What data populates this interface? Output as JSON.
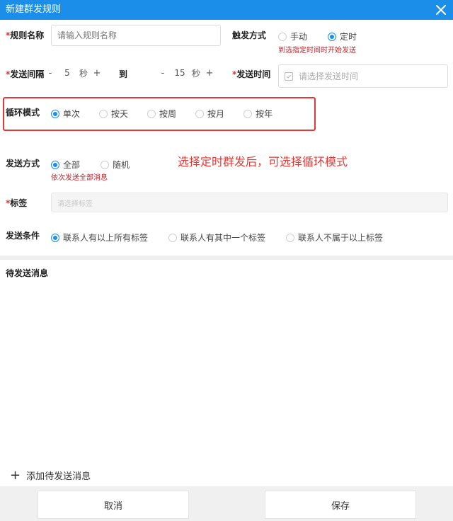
{
  "dialog": {
    "title": "新建群发规则"
  },
  "form": {
    "rule_name": {
      "required_mark": "*",
      "label": "规则名称",
      "placeholder": "请输入规则名称"
    },
    "trigger": {
      "label": "触发方式",
      "options": [
        "手动",
        "定时"
      ],
      "selected": "定时",
      "hint": "到选指定时间时开始发送"
    },
    "interval": {
      "required_mark": "*",
      "label": "发送间隔",
      "from": {
        "minus": "-",
        "value": "5",
        "unit": "秒",
        "plus": "+"
      },
      "to_label": "到",
      "to": {
        "minus": "-",
        "value": "15",
        "unit": "秒",
        "plus": "+"
      }
    },
    "send_time": {
      "required_mark": "*",
      "label": "发送时间",
      "placeholder": "请选择发送时间"
    },
    "loop_mode": {
      "label": "循环模式",
      "options": [
        "单次",
        "按天",
        "按周",
        "按月",
        "按年"
      ],
      "selected": "单次"
    },
    "send_method": {
      "label": "发送方式",
      "options": [
        "全部",
        "随机"
      ],
      "selected": "全部",
      "hint": "依次发送全部消息"
    },
    "tags": {
      "required_mark": "*",
      "label": "标签",
      "placeholder": "请选择标签"
    },
    "send_condition": {
      "label": "发送条件",
      "options": [
        "联系人有以上所有标签",
        "联系人有其中一个标签",
        "联系人不属于以上标签"
      ],
      "selected": "联系人有以上所有标签"
    }
  },
  "annotation": "选择定时群发后，可选择循环模式",
  "pending": {
    "title": "待发送消息",
    "add_icon": "+",
    "add_label": "添加待发送消息"
  },
  "footer": {
    "cancel": "取消",
    "save": "保存"
  },
  "colors": {
    "accent": "#1b8ee9",
    "highlight": "#e53935",
    "hint": "#c0262d"
  }
}
